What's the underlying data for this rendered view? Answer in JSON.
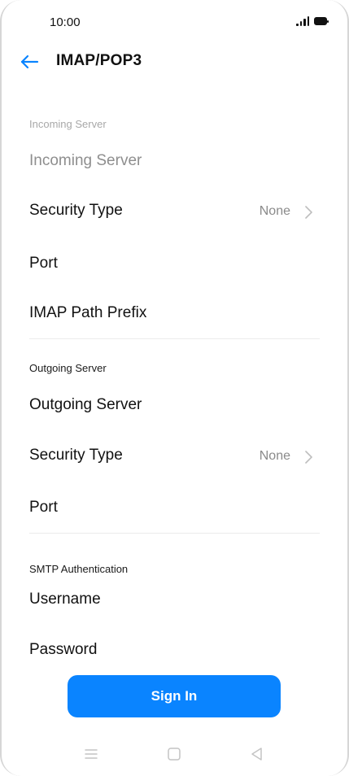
{
  "status_bar": {
    "time": "10:00",
    "signal_icon": "signal-icon",
    "battery_icon": "battery-icon"
  },
  "header": {
    "back_icon": "arrow-left-icon",
    "title": "IMAP/POP3",
    "accent_color": "#0a84ff"
  },
  "incoming": {
    "section_label": "Incoming Server",
    "server_placeholder": "Incoming Server",
    "security_label": "Security Type",
    "security_value": "None",
    "port_label": "Port",
    "path_prefix_label": "IMAP Path Prefix"
  },
  "outgoing": {
    "section_label": "Outgoing Server",
    "server_label": "Outgoing Server",
    "security_label": "Security Type",
    "security_value": "None",
    "port_label": "Port"
  },
  "smtp": {
    "section_label": "SMTP Authentication",
    "username_label": "Username",
    "password_label": "Password"
  },
  "sign_in_button": {
    "label": "Sign In",
    "color": "#0a84ff"
  },
  "nav_bar": {
    "menu_icon": "menu-icon",
    "home_icon": "home-square-icon",
    "back_icon": "back-triangle-icon"
  }
}
